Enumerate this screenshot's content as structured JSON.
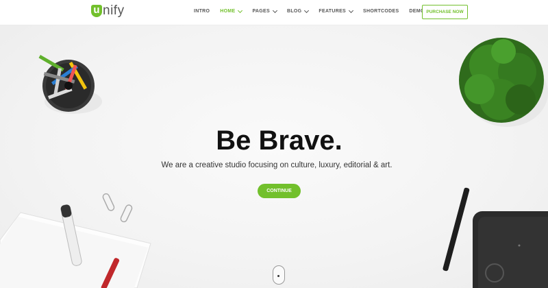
{
  "brand": {
    "logo_mark": "u",
    "logo_text": "nify",
    "accent": "#72c02c"
  },
  "nav": {
    "items": [
      {
        "label": "INTRO",
        "has_dropdown": false,
        "active": false
      },
      {
        "label": "HOME",
        "has_dropdown": true,
        "active": true
      },
      {
        "label": "PAGES",
        "has_dropdown": true,
        "active": false
      },
      {
        "label": "BLOG",
        "has_dropdown": true,
        "active": false
      },
      {
        "label": "FEATURES",
        "has_dropdown": true,
        "active": false
      },
      {
        "label": "SHORTCODES",
        "has_dropdown": false,
        "active": false
      },
      {
        "label": "DEMOS",
        "has_dropdown": true,
        "active": false
      }
    ],
    "purchase_label": "PURCHASE NOW"
  },
  "hero": {
    "title": "Be Brave.",
    "subtitle": "We are a creative studio focusing on culture, luxury, editorial & art.",
    "cta_label": "CONTINUE"
  },
  "icons": {
    "scroll": "mouse-scroll-icon",
    "dropdown": "chevron-down-icon"
  }
}
